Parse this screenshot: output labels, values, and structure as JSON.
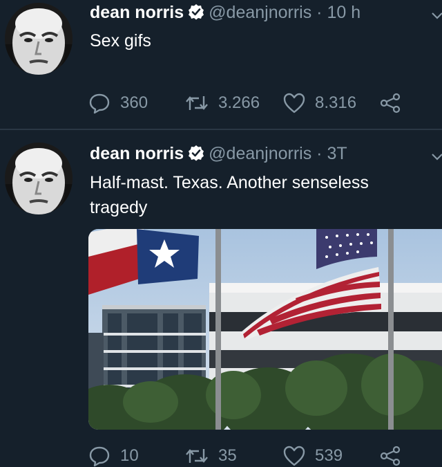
{
  "tweets": [
    {
      "author_name": "dean norris",
      "handle": "@deanjnorris",
      "separator": "·",
      "time": "10 h",
      "text": "Sex gifs",
      "replies": "360",
      "retweets": "3.266",
      "likes": "8.316"
    },
    {
      "author_name": "dean norris",
      "handle": "@deanjnorris",
      "separator": "·",
      "time": "3T",
      "text": "Half-mast. Texas. Another senseless tragedy",
      "replies": "10",
      "retweets": "35",
      "likes": "539",
      "media": "flags-half-mast-photo"
    }
  ],
  "colors": {
    "background": "#15202b",
    "secondary_text": "#8899a6",
    "verified_badge": "#ffffff",
    "divider": "#2a3744"
  },
  "icons": [
    "chevron-down-icon",
    "verified-badge-icon",
    "reply-icon",
    "retweet-icon",
    "like-icon",
    "share-icon"
  ]
}
